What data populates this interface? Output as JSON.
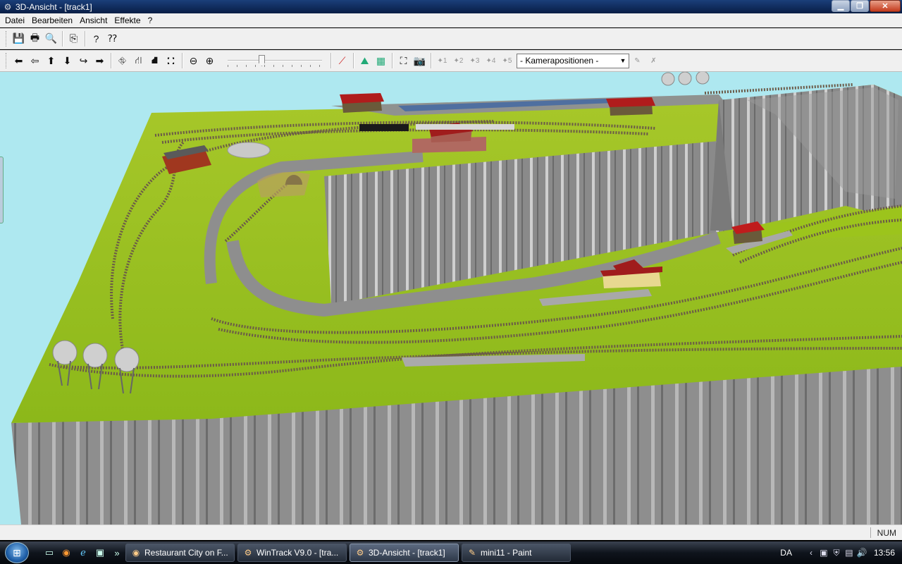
{
  "window": {
    "title": "3D-Ansicht - [track1]",
    "buttons": {
      "minimize": "▁",
      "maximize": "❐",
      "close": "✕"
    }
  },
  "menu": [
    "Datei",
    "Bearbeiten",
    "Ansicht",
    "Effekte",
    "?"
  ],
  "toolbar1": {
    "icons": [
      "save-icon",
      "print-icon",
      "print-preview-icon",
      "copy-icon",
      "help-icon",
      "context-help-icon"
    ]
  },
  "toolbar2": {
    "nav_icons": [
      "arrow-left-icon",
      "arrow-left-bold-icon",
      "arrow-up-icon",
      "arrow-down-icon",
      "rotate-left-icon",
      "arrow-right-icon"
    ],
    "camera_icons": [
      "walk-left-icon",
      "walk-right-icon",
      "walk-down-icon",
      "walk-up-icon"
    ],
    "zoom_icons": [
      "zoom-out-icon",
      "zoom-in-icon"
    ],
    "zoom_level": 0.35,
    "view_icons": [
      "track-tool-icon",
      "terrain-icon",
      "grid-icon",
      "fit-view-icon",
      "camera-icon"
    ],
    "preset_labels": [
      "1",
      "2",
      "3",
      "4",
      "5"
    ],
    "camera_select": "- Kamerapositionen -",
    "end_icons": [
      "camera-set-icon",
      "camera-delete-icon"
    ]
  },
  "statusbar": {
    "num": "NUM"
  },
  "taskbar": {
    "tasks": [
      {
        "label": "Restaurant City on F...",
        "icon": "firefox-icon",
        "active": false
      },
      {
        "label": "WinTrack  V9.0 - [tra...",
        "icon": "wintrack-icon",
        "active": false
      },
      {
        "label": "3D-Ansicht - [track1]",
        "icon": "wintrack-3d-icon",
        "active": true
      },
      {
        "label": "mini11 - Paint",
        "icon": "paint-icon",
        "active": false
      }
    ],
    "language": "DA",
    "clock": "13:56"
  },
  "colors": {
    "sky": "#aee8f0",
    "grass": "#9cc41c",
    "cliff": "#8a8a8a",
    "track": "#6b5a48",
    "road": "#8e8e8e"
  }
}
